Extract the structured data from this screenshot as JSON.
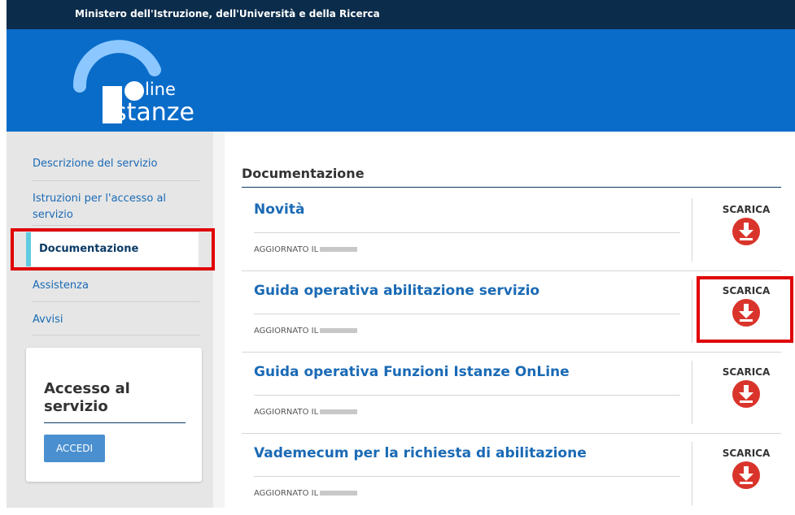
{
  "header": {
    "ministry": "Ministero dell'Istruzione, dell'Università e della Ricerca",
    "logo_online": "n line",
    "logo_istanze": "stanze"
  },
  "sidebar": {
    "items": [
      {
        "label": "Descrizione del servizio"
      },
      {
        "label": "Istruzioni per l'accesso al servizio"
      },
      {
        "label": "Documentazione"
      },
      {
        "label": "Assistenza"
      },
      {
        "label": "Avvisi"
      }
    ],
    "active_index": 2
  },
  "login": {
    "title": "Accesso al servizio",
    "button": "ACCEDI"
  },
  "main": {
    "title": "Documentazione",
    "docs": [
      {
        "title": "Novità",
        "updated_label": "AGGIORNATO IL",
        "action": "SCARICA"
      },
      {
        "title": "Guida operativa abilitazione servizio",
        "updated_label": "AGGIORNATO IL",
        "action": "SCARICA"
      },
      {
        "title": "Guida operativa Funzioni Istanze OnLine",
        "updated_label": "AGGIORNATO IL",
        "action": "SCARICA"
      },
      {
        "title": "Vademecum per la richiesta di abilitazione",
        "updated_label": "AGGIORNATO IL",
        "action": "SCARICA"
      }
    ]
  },
  "colors": {
    "topbar": "#0b2c4a",
    "header": "#0a6cc9",
    "link": "#1a6ab5",
    "download": "#d9342b",
    "highlight": "#e00000"
  },
  "icons": {
    "download": "download-arrow-circle-icon",
    "logo": "online-istanze-logo"
  }
}
